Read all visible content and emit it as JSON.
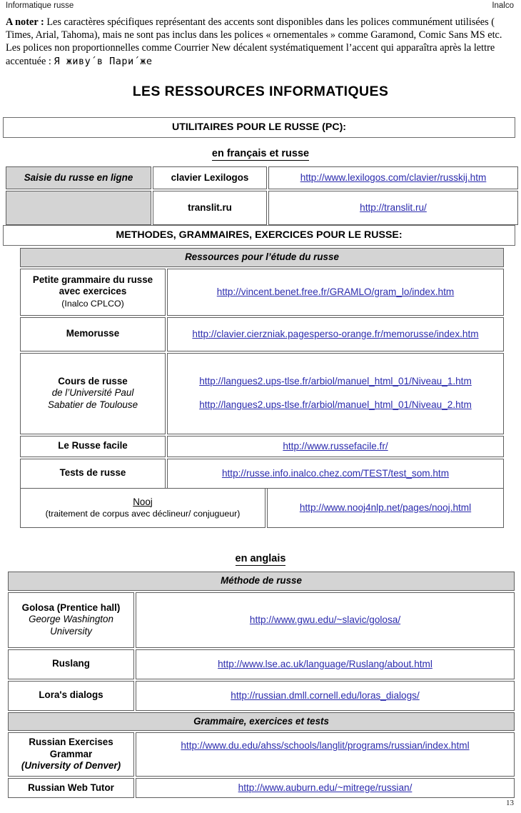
{
  "running_head": {
    "left": "Informatique russe",
    "right": "Inalco"
  },
  "note": {
    "label": "A noter :",
    "line1": " Les caractères spécifiques représentant des accents sont disponibles dans les polices communément utilisées (",
    "line2": "Times, Arial, Tahoma), mais ne sont pas inclus dans les polices « ornementales » comme Garamond, Comic Sans MS etc.",
    "line3": "Les polices non proportionnelles comme Courrier New  décalent systématiquement  l’accent qui apparaîtra après la lettre",
    "line4_prefix": "accentuée : ",
    "line4_cyrillic": "Я живу´в Пари´же"
  },
  "title": "LES RESSOURCES  INFORMATIQUES",
  "banners": {
    "utilitaires": "UTILITAIRES POUR LE RUSSE (PC):",
    "methodes": "METHODES, GRAMMAIRES, EXERCICES POUR LE RUSSE:"
  },
  "subheads": {
    "french": "en français et russe",
    "english": "en anglais"
  },
  "table_utilitaires": {
    "rows": [
      {
        "col1": "Saisie du russe  en ligne",
        "col2": "clavier Lexilogos",
        "url": "http://www.lexilogos.com/clavier/russkij.htm"
      },
      {
        "col1": "",
        "col2": "translit.ru",
        "url": "http://translit.ru/"
      }
    ]
  },
  "table_francais": {
    "section_header": "Ressources pour l’étude du russe",
    "rows": [
      {
        "name": "Petite grammaire du russe avec exercices",
        "sub": "(Inalco CPLCO)",
        "urls": [
          "http://vincent.benet.free.fr/GRAMLO/gram_lo/index.htm"
        ]
      },
      {
        "name": "Memorusse",
        "sub": "",
        "urls": [
          "http://clavier.cierzniak.pagesperso-orange.fr/memorusse/index.htm"
        ]
      },
      {
        "name": "Cours de russe",
        "italic1": "de l’Université Paul",
        "italic2": "Sabatier de Toulouse",
        "urls": [
          "http://langues2.ups-tlse.fr/arbiol/manuel_html_01/Niveau_1.htm",
          "http://langues2.ups-tlse.fr/arbiol/manuel_html_01/Niveau_2.htm"
        ]
      },
      {
        "name": "Le  Russe facile",
        "sub": "",
        "urls": [
          "http://www.russefacile.fr/"
        ]
      },
      {
        "name": "Tests de russe",
        "sub": "",
        "urls": [
          "http://russe.info.inalco.chez.com/TEST/test_som.htm"
        ]
      }
    ],
    "nooj_row": {
      "name": "Nooj",
      "sub": "(traitement de corpus avec déclineur/ conjugueur)",
      "url": "http://www.nooj4nlp.net/pages/nooj.html"
    }
  },
  "table_anglais": {
    "section_header_1": "Méthode de russe",
    "section_header_2": "Grammaire, exercices et tests",
    "rows_methode": [
      {
        "name": "Golosa (Prentice hall)",
        "italic": "George Washington University",
        "url": "http://www.gwu.edu/~slavic/golosa/"
      },
      {
        "name": "Ruslang",
        "italic": "",
        "url": "http://www.lse.ac.uk/language/Ruslang/about.html"
      },
      {
        "name": "Lora's dialogs",
        "italic": "",
        "url": "http://russian.dmll.cornell.edu/loras_dialogs/"
      }
    ],
    "rows_grammaire": [
      {
        "name": "Russian Exercises Grammar",
        "italic": "(University of Denver)",
        "url": "http://www.du.edu/ahss/schools/langlit/programs/russian/index.html"
      },
      {
        "name": "Russian Web Tutor",
        "italic": "",
        "url": "http://www.auburn.edu/~mitrege/russian/"
      }
    ]
  },
  "page_number": "13",
  "colors": {
    "link": "#2b2bad",
    "section_gray": "#d4d4d4",
    "border": "#5e5e5e"
  }
}
